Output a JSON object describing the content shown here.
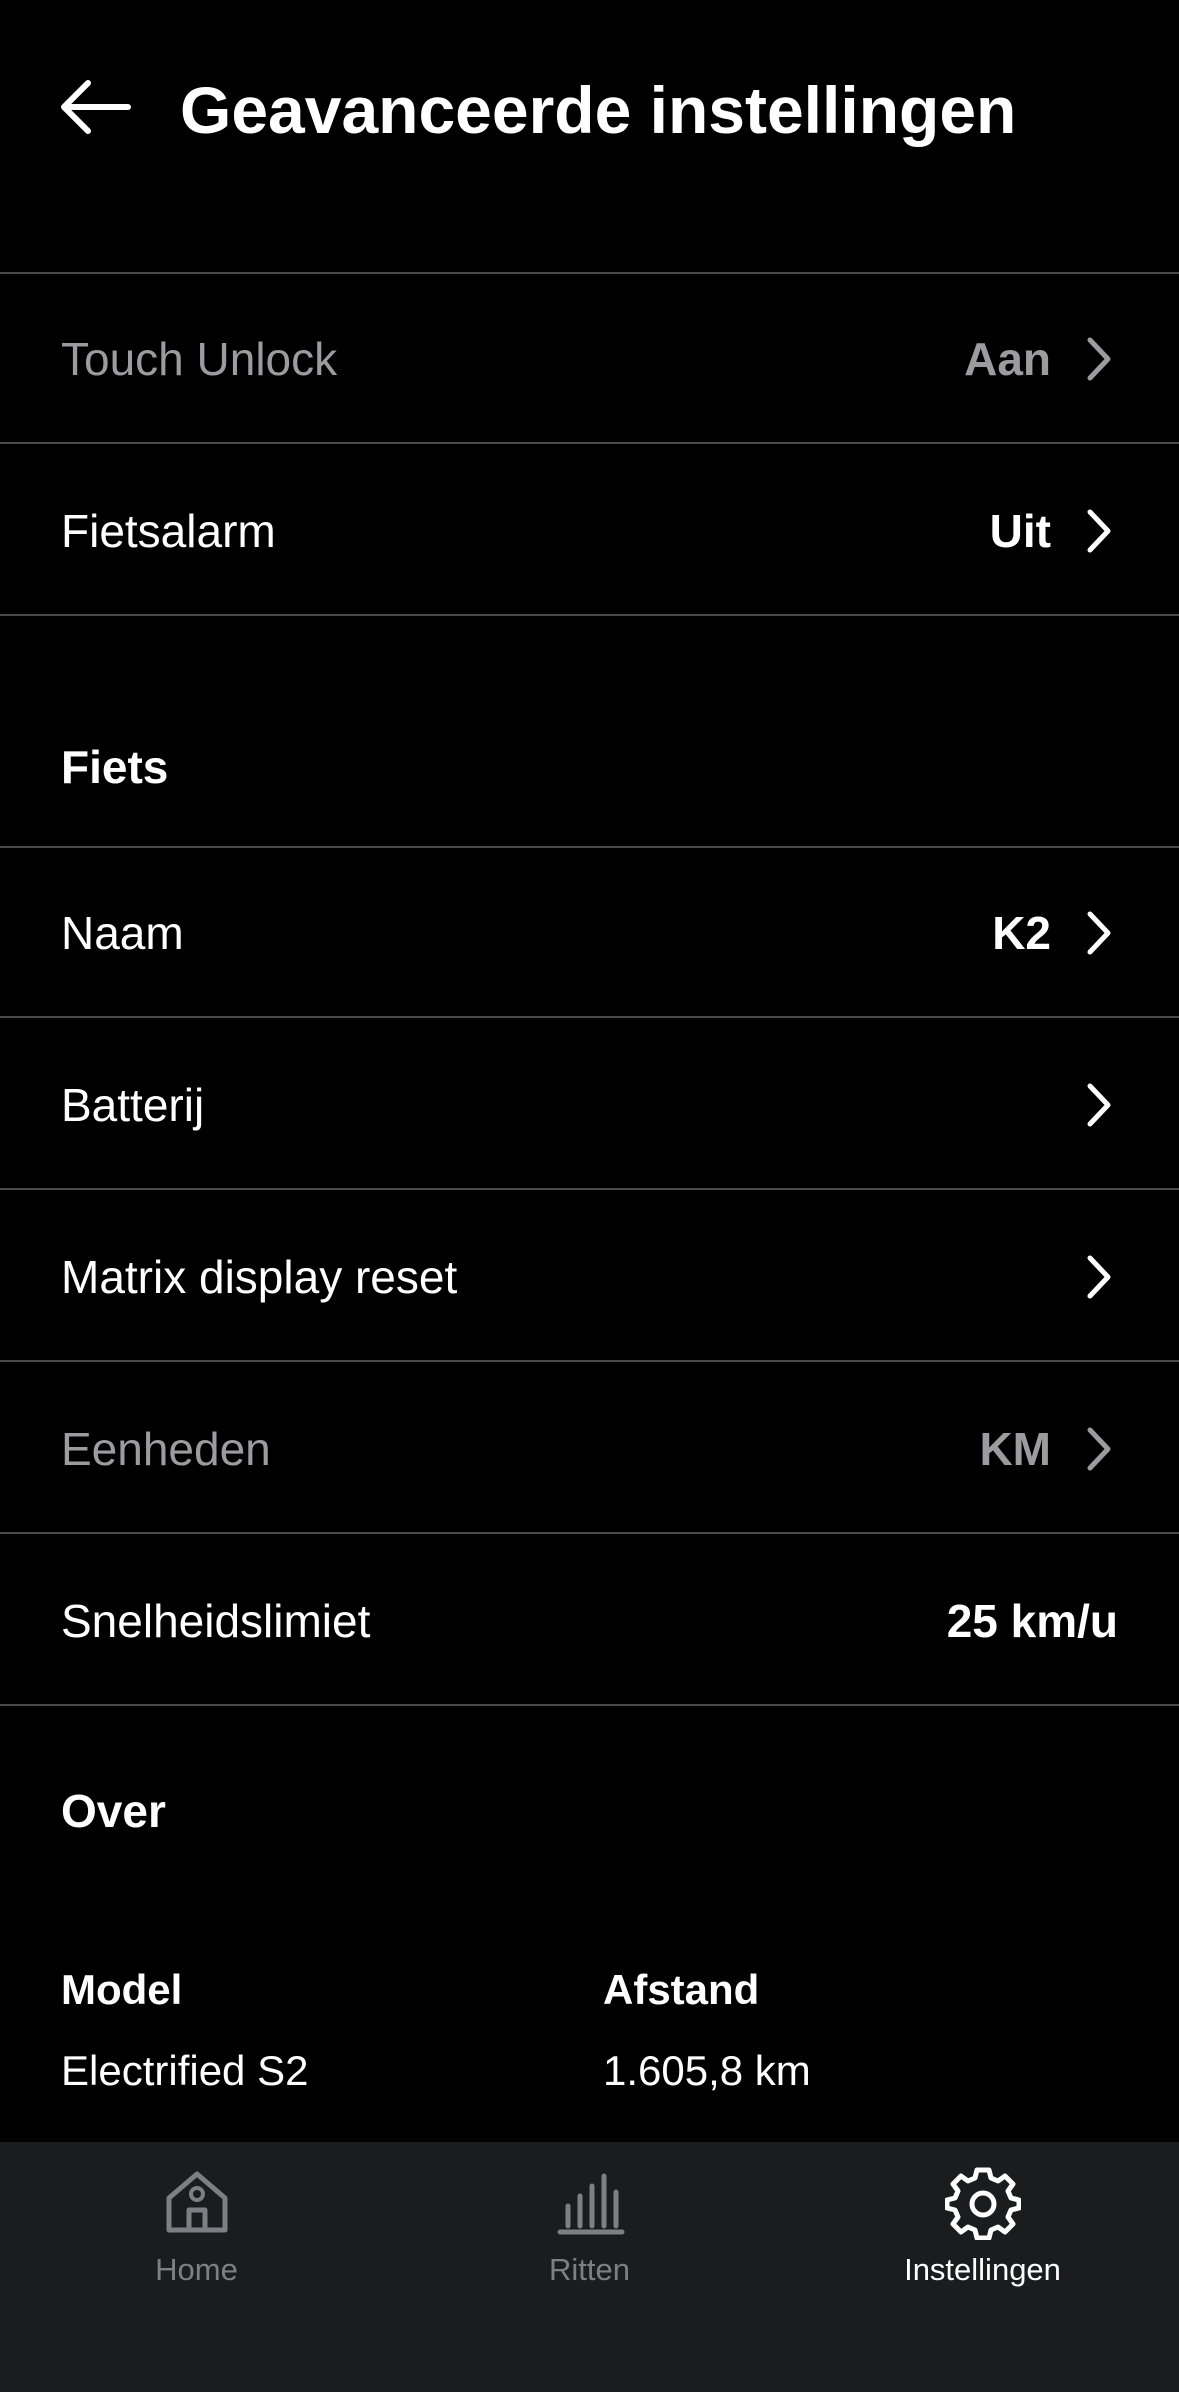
{
  "header": {
    "title": "Geavanceerde instellingen",
    "back_icon": "arrow-left-icon"
  },
  "security": {
    "clipped_row": {
      "label": "",
      "value": ""
    },
    "rows": [
      {
        "label": "Touch Unlock",
        "value": "Aan",
        "dimmed": true
      },
      {
        "label": "Fietsalarm",
        "value": "Uit",
        "dimmed": false
      }
    ]
  },
  "bike": {
    "section_title": "Fiets",
    "rows": [
      {
        "label": "Naam",
        "value": "K2"
      },
      {
        "label": "Batterij",
        "value": ""
      },
      {
        "label": "Matrix display reset",
        "value": ""
      },
      {
        "label": "Eenheden",
        "value": "KM",
        "dimmed": true
      },
      {
        "label": "Snelheidslimiet",
        "value": "25 km/u"
      }
    ]
  },
  "about": {
    "section_title": "Over",
    "model_label": "Model",
    "model_value": "Electrified S2",
    "distance_label": "Afstand",
    "distance_value": "1.605,8 km"
  },
  "tabbar": {
    "tabs": [
      {
        "label": "Home",
        "icon": "home-icon",
        "active": false
      },
      {
        "label": "Ritten",
        "icon": "bar-chart-icon",
        "active": false
      },
      {
        "label": "Instellingen",
        "icon": "gear-icon",
        "active": true
      }
    ]
  },
  "colors": {
    "background": "#000000",
    "divider": "#4a4a4c",
    "dimmed_text": "#9c9ca0",
    "tabbar_background": "#1b1c1e",
    "tab_inactive": "#7d7f84",
    "tab_active": "#ffffff"
  }
}
